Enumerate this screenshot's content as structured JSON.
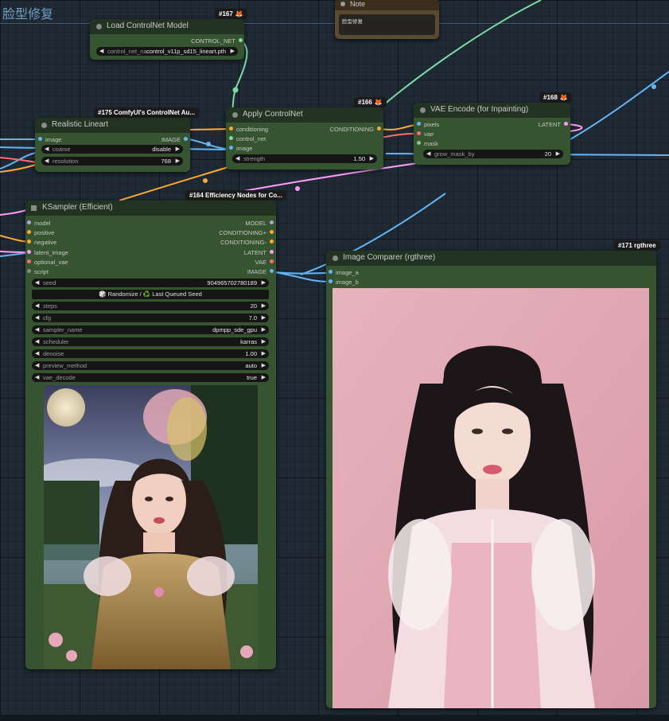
{
  "group": {
    "title": "脸型修复"
  },
  "note": {
    "title": "Note",
    "text": "脸型修复"
  },
  "load_controlnet": {
    "badge": "#167",
    "title": "Load ControlNet Model",
    "output": "CONTROL_NET",
    "widget_label": "control_net_na",
    "widget_value": "control_v11p_sd15_lineart.pth"
  },
  "lineart": {
    "badge": "#175 ComfyUI's ControlNet Au...",
    "title": "Realistic Lineart",
    "input": "image",
    "output": "IMAGE",
    "widgets": [
      {
        "label": "coarse",
        "value": "disable"
      },
      {
        "label": "resolution",
        "value": "768"
      }
    ]
  },
  "apply_controlnet": {
    "badge": "#166",
    "title": "Apply ControlNet",
    "inputs": [
      "conditioning",
      "control_net",
      "image"
    ],
    "output": "CONDITIONING",
    "widget_label": "strength",
    "widget_value": "1.50"
  },
  "vae_encode": {
    "badge": "#168",
    "title": "VAE Encode (for Inpainting)",
    "inputs": [
      "pixels",
      "vae",
      "mask"
    ],
    "output": "LATENT",
    "widget_label": "grow_mask_by",
    "widget_value": "20"
  },
  "ksampler": {
    "badge": "#164 Efficiency Nodes for Co...",
    "title": "KSampler (Efficient)",
    "inputs": [
      "model",
      "positive",
      "negative",
      "latent_image",
      "optional_vae",
      "script"
    ],
    "outputs": [
      "MODEL",
      "CONDITIONING+",
      "CONDITIONING-",
      "LATENT",
      "VAE",
      "IMAGE"
    ],
    "seed_label": "seed",
    "seed_value": "904965702780189",
    "seed_button": "🎲 Randomize / ♻️ Last Queued Seed",
    "widgets": [
      {
        "label": "steps",
        "value": "20"
      },
      {
        "label": "cfg",
        "value": "7.0"
      },
      {
        "label": "sampler_name",
        "value": "dpmpp_sde_gpu"
      },
      {
        "label": "scheduler",
        "value": "karras"
      },
      {
        "label": "denoise",
        "value": "1.00"
      },
      {
        "label": "preview_method",
        "value": "auto"
      },
      {
        "label": "vae_decode",
        "value": "true"
      }
    ]
  },
  "comparer": {
    "badge": "#171 rgthree",
    "title": "Image Comparer (rgthree)",
    "inputs": [
      "image_a",
      "image_b"
    ]
  },
  "colors": {
    "node_body": "#35542f",
    "node_header": "#233322",
    "wire_image": "#64b5f6",
    "wire_conditioning": "#ffa931",
    "wire_control_net": "#7ed9a4",
    "wire_latent": "#ff9cf9",
    "wire_vae": "#ff6e6e"
  }
}
